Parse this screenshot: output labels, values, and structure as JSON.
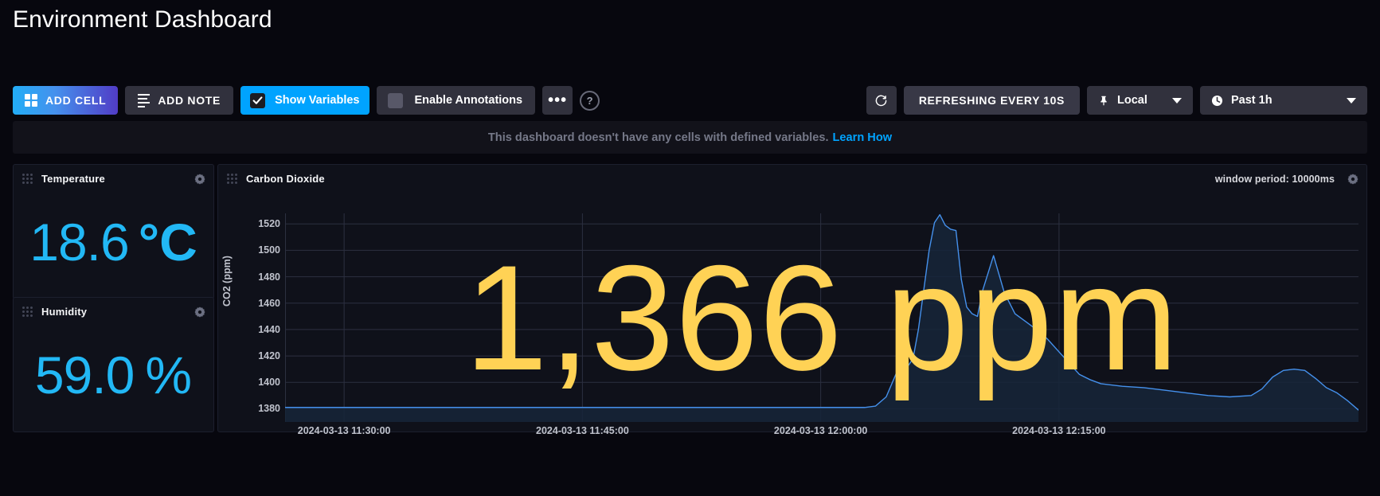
{
  "header": {
    "title": "Environment Dashboard"
  },
  "toolbar": {
    "add_cell_label": "ADD CELL",
    "add_note_label": "ADD NOTE",
    "show_variables_label": "Show Variables",
    "enable_annotations_label": "Enable Annotations",
    "more_label": "•••",
    "help_label": "?",
    "refresh_icon": "refresh-icon",
    "refreshing_label": "REFRESHING EVERY 10S",
    "timezone_label": "Local",
    "time_range_label": "Past 1h",
    "show_variables_checked": true,
    "enable_annotations_checked": false,
    "accent_blue": "#00a3ff",
    "gradient_start": "#22adf6",
    "gradient_end": "#513cc6"
  },
  "variables_banner": {
    "message": "This dashboard doesn't have any cells with defined variables.",
    "link_label": "Learn How",
    "link_color": "#00a3ff"
  },
  "cells": {
    "temperature": {
      "title": "Temperature",
      "value": "18.6",
      "suffix": "°C",
      "color": "#22b8f5"
    },
    "humidity": {
      "title": "Humidity",
      "value": "59.0",
      "suffix": "%",
      "color": "#22b8f5"
    },
    "carbon_dioxide": {
      "title": "Carbon Dioxide",
      "window_period": "window period: 10000ms",
      "overlay_value": "1,366 ppm",
      "overlay_color": "#ffd255"
    }
  },
  "chart_data": {
    "type": "line",
    "title": "Carbon Dioxide",
    "xlabel": "",
    "ylabel": "CO2 (ppm)",
    "ylim": [
      1370,
      1528
    ],
    "yticks": [
      1380,
      1400,
      1420,
      1440,
      1460,
      1480,
      1500,
      1520
    ],
    "xticks": [
      "2024-03-13 11:30:00",
      "2024-03-13 11:45:00",
      "2024-03-13 12:00:00",
      "2024-03-13 12:15:00"
    ],
    "xtick_positions_pct": [
      5.5,
      27.7,
      49.9,
      72.1
    ],
    "grid": true,
    "legend": false,
    "line_color": "#4591ed",
    "fill_color": "#16263a",
    "series": [
      {
        "name": "CO2 (ppm)",
        "x_pct": [
          0,
          2,
          4,
          6,
          8,
          10,
          12,
          14,
          16,
          18,
          20,
          22,
          24,
          26,
          28,
          30,
          32,
          34,
          36,
          38,
          40,
          42,
          44,
          46,
          48,
          50,
          52,
          54,
          55,
          56,
          57,
          58,
          58.5,
          59,
          59.5,
          60,
          60.5,
          61,
          61.5,
          62,
          62.5,
          63,
          63.5,
          64,
          64.5,
          65,
          66,
          67,
          68,
          69,
          70,
          71,
          72,
          73,
          74,
          75,
          76,
          78,
          80,
          82,
          84,
          86,
          88,
          90,
          91,
          92,
          93,
          94,
          95,
          96,
          97,
          98,
          99,
          100
        ],
        "values": [
          1381,
          1381,
          1381,
          1381,
          1381,
          1381,
          1381,
          1381,
          1381,
          1381,
          1381,
          1381,
          1381,
          1381,
          1381,
          1381,
          1381,
          1381,
          1381,
          1381,
          1381,
          1381,
          1381,
          1381,
          1381,
          1381,
          1381,
          1381,
          1382,
          1389,
          1408,
          1412,
          1418,
          1440,
          1470,
          1500,
          1521,
          1527,
          1519,
          1516,
          1515,
          1478,
          1457,
          1452,
          1450,
          1470,
          1496,
          1468,
          1452,
          1446,
          1440,
          1433,
          1424,
          1415,
          1406,
          1402,
          1399,
          1397,
          1396,
          1394,
          1392,
          1390,
          1389,
          1390,
          1395,
          1404,
          1409,
          1410,
          1409,
          1403,
          1396,
          1392,
          1386,
          1379
        ]
      }
    ]
  }
}
